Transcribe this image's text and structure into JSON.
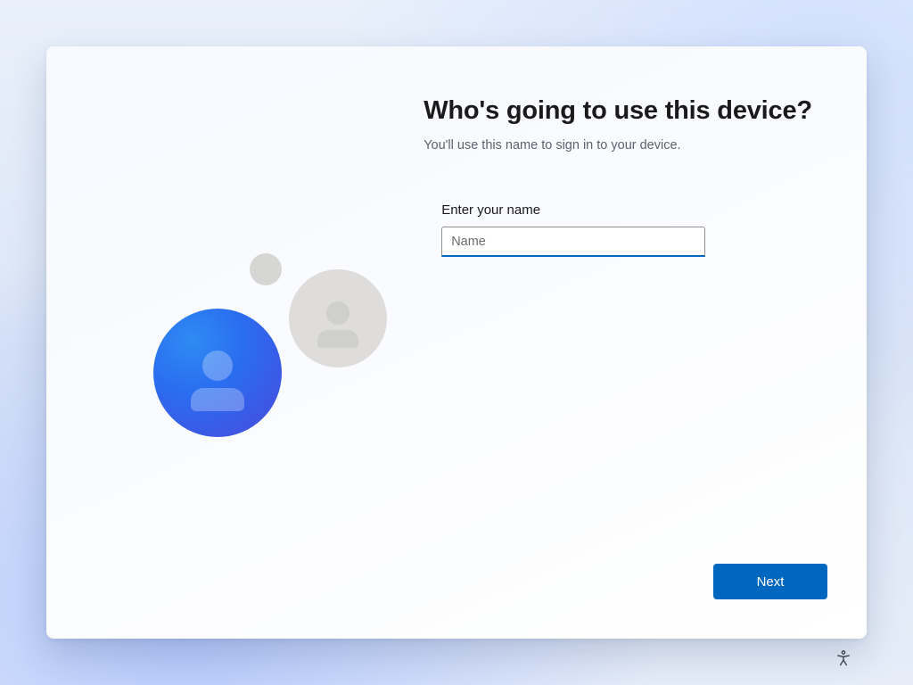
{
  "page": {
    "title": "Who's going to use this device?",
    "subtitle": "You'll use this name to sign in to your device."
  },
  "form": {
    "name_label": "Enter your name",
    "name_placeholder": "Name",
    "name_value": ""
  },
  "actions": {
    "next_label": "Next"
  },
  "icons": {
    "accessibility": "accessibility-icon",
    "user_large": "user-avatar-blue-icon",
    "user_small": "user-avatar-grey-icon"
  },
  "colors": {
    "accent": "#0067c0"
  }
}
